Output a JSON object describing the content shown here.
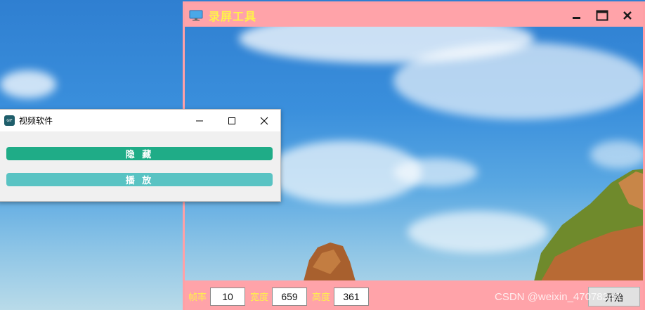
{
  "recorder": {
    "title": "录屏工具",
    "fields": [
      {
        "label": "帧率",
        "value": "10"
      },
      {
        "label": "宽度",
        "value": "659"
      },
      {
        "label": "高度",
        "value": "361"
      }
    ],
    "start_label": "开始"
  },
  "video_app": {
    "title": "视频软件",
    "icon_text": "GIF",
    "hide_label": "隐 藏",
    "play_label": "播 放"
  },
  "watermark": "CSDN @weixin_47078346",
  "colors": {
    "recorder_frame": "#ffa3a9",
    "recorder_title_text": "#fff24a",
    "hide_button": "#1fac87",
    "play_button": "#59c3c3"
  },
  "icons": {
    "recorder_title": "monitor-icon",
    "recorder_controls": [
      "minimize-icon",
      "maximize-icon",
      "close-icon"
    ],
    "video_controls": [
      "minimize-icon",
      "maximize-icon",
      "close-icon"
    ]
  }
}
